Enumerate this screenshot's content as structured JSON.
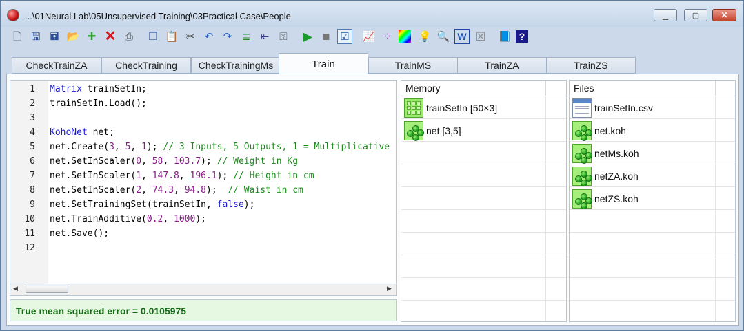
{
  "window": {
    "title": "...\\01Neural Lab\\05Unsupervised Training\\03Practical Case\\People",
    "buttons": {
      "minimize": "▁",
      "maximize": "▢",
      "close": "✕"
    }
  },
  "toolbar": {
    "icons": [
      "new-file-icon",
      "save-icon",
      "save-as-icon",
      "open-folder-icon",
      "add-icon",
      "delete-icon",
      "print-icon",
      "copy-icon",
      "paste-icon",
      "cut-icon",
      "undo-icon",
      "redo-icon",
      "align-icon",
      "outdent-icon",
      "key-icon",
      "run-icon",
      "stop-icon",
      "check-icon",
      "chart-icon",
      "dots-icon",
      "color-icon",
      "bulb-icon",
      "preview-icon",
      "word-icon",
      "clear-icon",
      "book-icon",
      "help-icon"
    ]
  },
  "tabs": [
    {
      "label": "CheckTrainZA",
      "active": false
    },
    {
      "label": "CheckTraining",
      "active": false
    },
    {
      "label": "CheckTrainingMs",
      "active": false
    },
    {
      "label": "Train",
      "active": true
    },
    {
      "label": "TrainMS",
      "active": false
    },
    {
      "label": "TrainZA",
      "active": false
    },
    {
      "label": "TrainZS",
      "active": false
    }
  ],
  "editor": {
    "lines": [
      {
        "n": "1",
        "parts": [
          [
            "kw",
            "Matrix"
          ],
          [
            "t",
            " trainSetIn;"
          ]
        ]
      },
      {
        "n": "2",
        "parts": [
          [
            "t",
            "trainSetIn.Load();"
          ]
        ]
      },
      {
        "n": "3",
        "parts": []
      },
      {
        "n": "4",
        "parts": [
          [
            "kw",
            "KohoNet"
          ],
          [
            "t",
            " net;"
          ]
        ]
      },
      {
        "n": "5",
        "parts": [
          [
            "t",
            "net.Create("
          ],
          [
            "num",
            "3"
          ],
          [
            "t",
            ", "
          ],
          [
            "num",
            "5"
          ],
          [
            "t",
            ", "
          ],
          [
            "num",
            "1"
          ],
          [
            "t",
            "); "
          ],
          [
            "cm",
            "// 3 Inputs, 5 Outputs, 1 = Multiplicative"
          ]
        ]
      },
      {
        "n": "6",
        "parts": [
          [
            "t",
            "net.SetInScaler("
          ],
          [
            "num",
            "0"
          ],
          [
            "t",
            ", "
          ],
          [
            "num",
            "58"
          ],
          [
            "t",
            ", "
          ],
          [
            "num",
            "103.7"
          ],
          [
            "t",
            "); "
          ],
          [
            "cm",
            "// Weight in Kg"
          ]
        ]
      },
      {
        "n": "7",
        "parts": [
          [
            "t",
            "net.SetInScaler("
          ],
          [
            "num",
            "1"
          ],
          [
            "t",
            ", "
          ],
          [
            "num",
            "147.8"
          ],
          [
            "t",
            ", "
          ],
          [
            "num",
            "196.1"
          ],
          [
            "t",
            "); "
          ],
          [
            "cm",
            "// Height in cm"
          ]
        ]
      },
      {
        "n": "8",
        "parts": [
          [
            "t",
            "net.SetInScaler("
          ],
          [
            "num",
            "2"
          ],
          [
            "t",
            ", "
          ],
          [
            "num",
            "74.3"
          ],
          [
            "t",
            ", "
          ],
          [
            "num",
            "94.8"
          ],
          [
            "t",
            ");  "
          ],
          [
            "cm",
            "// Waist in cm"
          ]
        ]
      },
      {
        "n": "9",
        "parts": [
          [
            "t",
            "net.SetTrainingSet(trainSetIn, "
          ],
          [
            "kw",
            "false"
          ],
          [
            "t",
            ");"
          ]
        ]
      },
      {
        "n": "10",
        "parts": [
          [
            "t",
            "net.TrainAdditive("
          ],
          [
            "num",
            "0.2"
          ],
          [
            "t",
            ", "
          ],
          [
            "num",
            "1000"
          ],
          [
            "t",
            ");"
          ]
        ]
      },
      {
        "n": "11",
        "parts": [
          [
            "t",
            "net.Save();"
          ]
        ]
      },
      {
        "n": "12",
        "parts": []
      }
    ],
    "colors": {
      "keyword": "#1a1ad0",
      "number": "#8a1a8a",
      "comment": "#1c8a1c"
    }
  },
  "status": {
    "text": "True mean squared error = 0.0105975"
  },
  "memory": {
    "title": "Memory",
    "items": [
      {
        "label": "trainSetIn [50×3]",
        "icon": "matrix-icon"
      },
      {
        "label": "net [3,5]",
        "icon": "neural-net-icon"
      }
    ]
  },
  "files": {
    "title": "Files",
    "items": [
      {
        "label": "trainSetIn.csv",
        "icon": "csv-file-icon"
      },
      {
        "label": "net.koh",
        "icon": "neural-net-icon"
      },
      {
        "label": "netMs.koh",
        "icon": "neural-net-icon"
      },
      {
        "label": "netZA.koh",
        "icon": "neural-net-icon"
      },
      {
        "label": "netZS.koh",
        "icon": "neural-net-icon"
      }
    ]
  }
}
